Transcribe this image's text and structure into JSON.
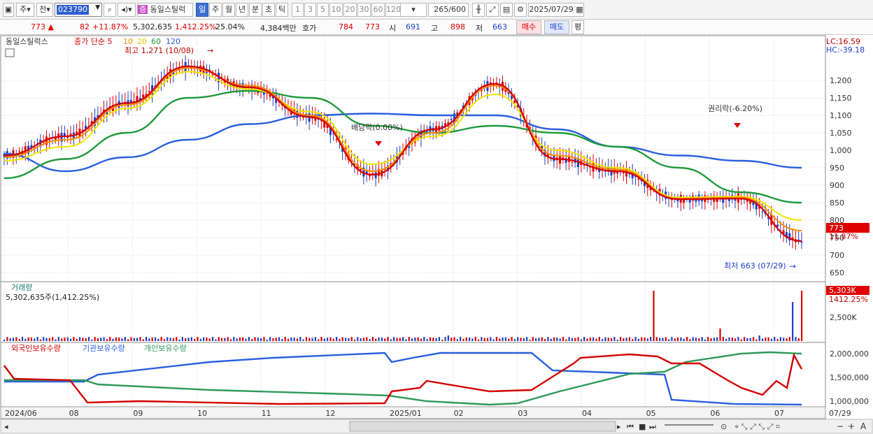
{
  "toolbar": {
    "week_label": "주",
    "prev_label": "전",
    "code": "023790",
    "stock_badge": "증",
    "stock_name": "동일스틸럭",
    "periods": [
      "일",
      "주",
      "월",
      "년",
      "분",
      "초",
      "틱"
    ],
    "active_period": "일",
    "intervals": [
      "1",
      "3",
      "5",
      "10",
      "20",
      "30",
      "60",
      "120"
    ],
    "count": "265",
    "count_total": "/600",
    "date": "2025/07/29"
  },
  "quote": {
    "price": "773",
    "change": "82",
    "change_pct": "+11.87%",
    "volume": "5,302,635",
    "volume_pct": "1,412.25%",
    "turnover_pct": "25.04%",
    "trade_value": "4,384백만",
    "bid_label": "호가",
    "bid": "784",
    "ask": "773",
    "open_label": "시",
    "open": "691",
    "high_label": "고",
    "high": "898",
    "low_label": "저",
    "low": "663",
    "buy_label": "매수",
    "sell_label": "매도",
    "eval_label": "평"
  },
  "legend": {
    "name": "동일스틸럭스",
    "ma_prefix": "종가 단순 5",
    "ma10": "10",
    "ma20": "20",
    "ma60": "60",
    "ma120": "120"
  },
  "annotations": {
    "high": "최고 1,271 (10/08)",
    "low": "최저 663 (07/29)",
    "dividend": "배당락(0.00%)",
    "rights": "권리락(-6.20%)"
  },
  "right_info": {
    "lc": "LC:16.59",
    "hc": "HC:-39.18"
  },
  "price_axis": [
    "1,200",
    "1,150",
    "1,100",
    "1,050",
    "1,000",
    "950",
    "900",
    "850",
    "800",
    "750",
    "700",
    "650"
  ],
  "price_tag": {
    "value": "773",
    "pct": "11.87%"
  },
  "volume_panel": {
    "title": "거래량",
    "value": "5,302,635주(1,412.25%)",
    "tag_value": "5,303K",
    "tag_pct": "1412.25%",
    "axis": "2,500K"
  },
  "holdings_panel": {
    "foreign": "외국인보유수량",
    "inst": "기관보유수량",
    "indiv": "개인보유수량",
    "axis": [
      "2,000,000",
      "1,500,000",
      "1,000,000"
    ]
  },
  "date_axis": [
    "2024/06",
    "08",
    "09",
    "10",
    "11",
    "12",
    "2025/01",
    "02",
    "03",
    "04",
    "05",
    "06",
    "07",
    "07/29"
  ],
  "colors": {
    "up": "#e00000",
    "down": "#1c3fcc",
    "ma5": "#d40000",
    "ma10": "#ff8c00",
    "ma20": "#f2e600",
    "ma60": "#1e9a3a",
    "ma120": "#2a5ee0",
    "foreign": "#d40000",
    "inst": "#2a5ee0",
    "indiv": "#2e9a5a"
  },
  "chart_data": {
    "type": "line",
    "x": [
      "2024/06",
      "08",
      "09",
      "10",
      "11",
      "12",
      "2025/01",
      "02",
      "03",
      "04",
      "05",
      "06",
      "07",
      "07/29"
    ],
    "series": [
      {
        "name": "5",
        "values": [
          985,
          1040,
          1135,
          1240,
          1180,
          1095,
          930,
          1060,
          1190,
          975,
          940,
          860,
          862,
          740
        ]
      },
      {
        "name": "10",
        "values": [
          980,
          1030,
          1130,
          1235,
          1185,
          1100,
          940,
          1050,
          1185,
          985,
          945,
          862,
          865,
          770
        ]
      },
      {
        "name": "20",
        "values": [
          970,
          1010,
          1120,
          1225,
          1175,
          1110,
          960,
          1040,
          1160,
          1000,
          950,
          865,
          868,
          800
        ]
      },
      {
        "name": "60",
        "values": [
          920,
          975,
          1050,
          1150,
          1170,
          1150,
          1070,
          1050,
          1070,
          1050,
          1010,
          950,
          880,
          850
        ]
      },
      {
        "name": "120",
        "values": [
          990,
          940,
          980,
          1030,
          1075,
          1100,
          1105,
          1100,
          1100,
          1060,
          1010,
          985,
          970,
          950
        ]
      }
    ],
    "ylim": [
      640,
      1270
    ]
  }
}
